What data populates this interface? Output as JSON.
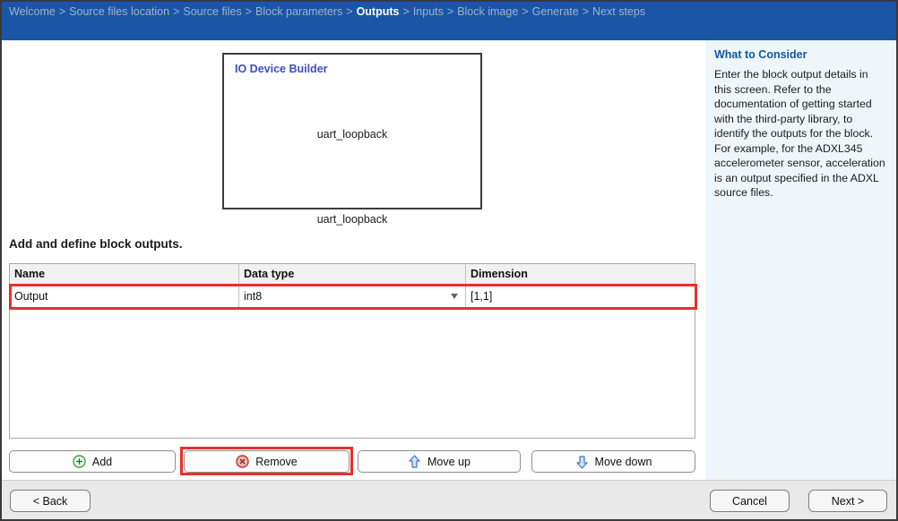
{
  "breadcrumb": {
    "separator": ">",
    "items": [
      "Welcome",
      "Source files location",
      "Source files",
      "Block parameters",
      "Outputs",
      "Inputs",
      "Block image",
      "Generate",
      "Next steps"
    ],
    "active_item": "Outputs"
  },
  "block_preview": {
    "title": "IO Device Builder",
    "block_label": "uart_loopback",
    "caption": "uart_loopback"
  },
  "main": {
    "instruction": "Add and define block outputs.",
    "table": {
      "columns": [
        "Name",
        "Data type",
        "Dimension"
      ],
      "rows": [
        {
          "name": "Output",
          "data_type": "int8",
          "dimension": "[1,1]"
        }
      ]
    },
    "buttons": {
      "add": "Add",
      "remove": "Remove",
      "move_up": "Move up",
      "move_down": "Move down"
    }
  },
  "sidebar": {
    "title": "What to Consider",
    "body": "Enter the block output details in this screen. Refer to the documentation of getting started with the third-party library, to identify the outputs for the block. For example, for the ADXL345 accelerometer sensor, acceleration is an output specified in the ADXL source files."
  },
  "footer": {
    "back": "< Back",
    "cancel": "Cancel",
    "next": "Next >"
  },
  "colors": {
    "header_bg": "#1a56a5",
    "breadcrumb_inactive": "#9fb1c9",
    "breadcrumb_active": "#ffffff",
    "annotation_red": "#e8302a",
    "sidebar_bg": "#eef6fc",
    "sidebar_heading": "#15569c",
    "block_title_blue": "#3d4ec0",
    "footer_bg": "#e9e9e9"
  }
}
